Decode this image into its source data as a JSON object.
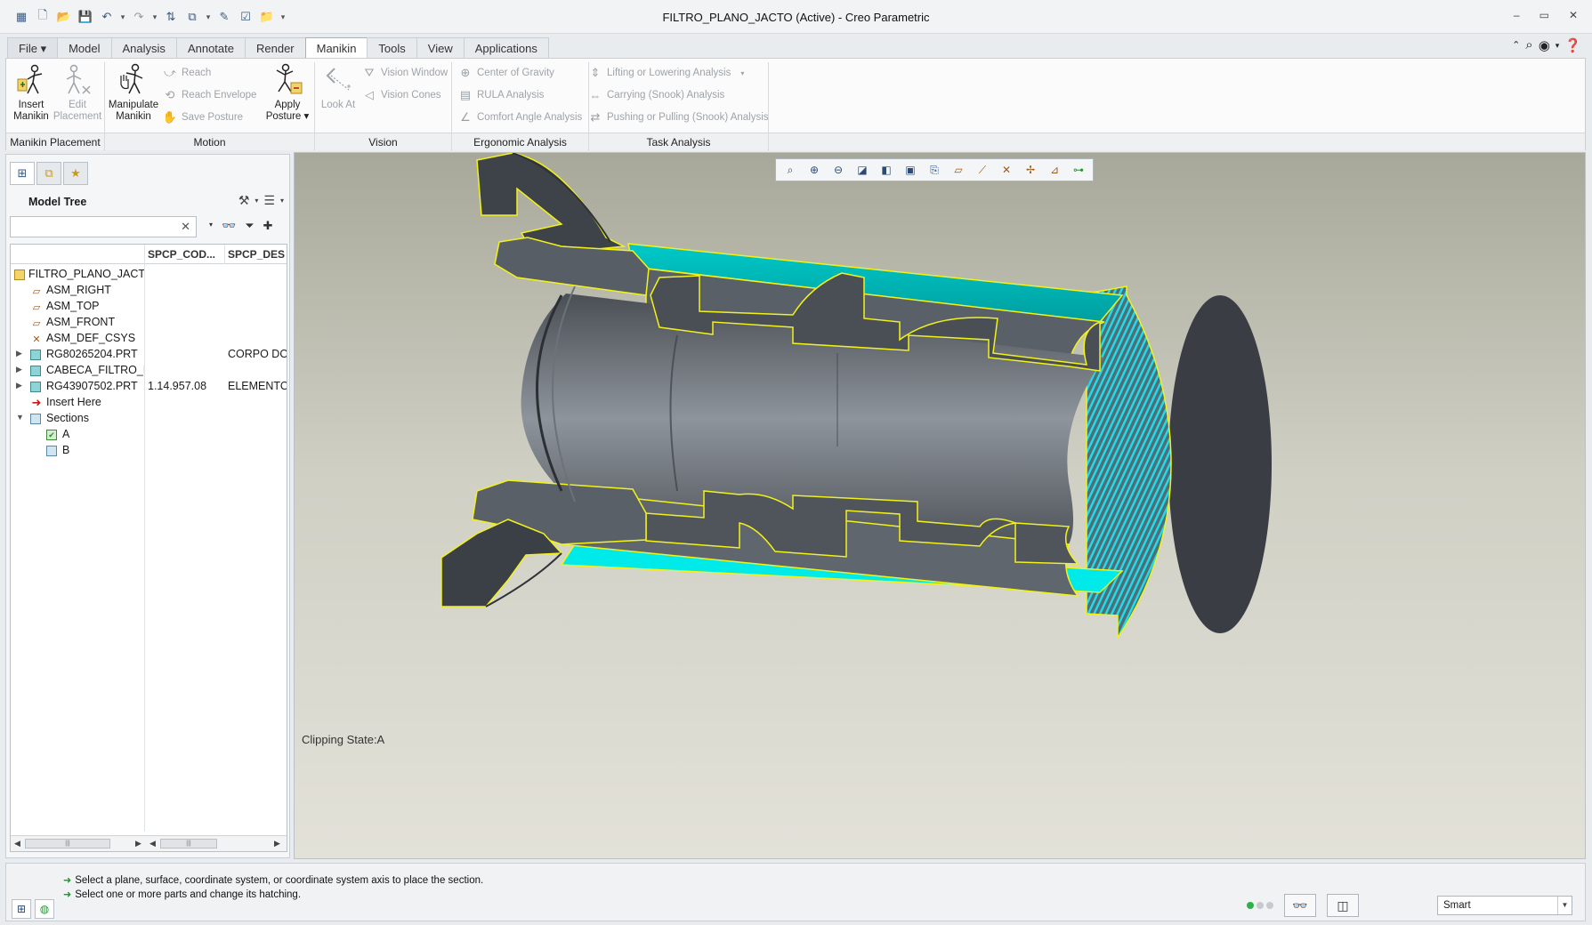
{
  "window": {
    "title": "FILTRO_PLANO_JACTO (Active) - Creo Parametric",
    "controls": [
      "minimize",
      "restore",
      "close"
    ]
  },
  "quick_access": [
    "app-icon",
    "new-icon",
    "open-icon",
    "save-icon",
    "undo-icon",
    "redo-icon",
    "regenerate-icon",
    "windows-icon",
    "edit-icon",
    "window-icon",
    "folder-icon",
    "customize-icon"
  ],
  "tabs": [
    {
      "label": "File",
      "dropdown": true
    },
    {
      "label": "Model"
    },
    {
      "label": "Analysis"
    },
    {
      "label": "Annotate"
    },
    {
      "label": "Render"
    },
    {
      "label": "Manikin",
      "active": true
    },
    {
      "label": "Tools"
    },
    {
      "label": "View"
    },
    {
      "label": "Applications"
    }
  ],
  "ribbon": {
    "groups": {
      "placement": "Manikin Placement",
      "motion": "Motion",
      "vision": "Vision",
      "ergonomic": "Ergonomic Analysis",
      "task": "Task Analysis"
    },
    "buttons": {
      "insert_manikin": [
        "Insert",
        "Manikin"
      ],
      "edit_placement": [
        "Edit",
        "Placement"
      ],
      "manipulate_manikin": [
        "Manipulate",
        "Manikin"
      ],
      "reach": "Reach",
      "reach_envelope": "Reach Envelope",
      "save_posture": "Save Posture",
      "apply_posture": [
        "Apply",
        "Posture"
      ],
      "look_at": "Look At",
      "vision_window": "Vision Window",
      "vision_cones": "Vision Cones",
      "center_of_gravity": "Center of Gravity",
      "rula_analysis": "RULA Analysis",
      "comfort_angle_analysis": "Comfort Angle Analysis",
      "lifting_lowering": "Lifting or Lowering Analysis",
      "carrying": "Carrying (Snook) Analysis",
      "pushing_pulling": "Pushing or Pulling (Snook) Analysis"
    }
  },
  "model_tree": {
    "title": "Model Tree",
    "search_value": "",
    "columns": [
      "SPCP_COD...",
      "SPCP_DES"
    ],
    "rows": [
      {
        "name": "FILTRO_PLANO_JACTO",
        "icon": "assembly-icon",
        "level": 0,
        "col2": "",
        "col3": ""
      },
      {
        "name": "ASM_RIGHT",
        "icon": "datum-plane-icon",
        "level": 1,
        "col2": "",
        "col3": ""
      },
      {
        "name": "ASM_TOP",
        "icon": "datum-plane-icon",
        "level": 1,
        "col2": "",
        "col3": ""
      },
      {
        "name": "ASM_FRONT",
        "icon": "datum-plane-icon",
        "level": 1,
        "col2": "",
        "col3": ""
      },
      {
        "name": "ASM_DEF_CSYS",
        "icon": "csys-icon",
        "level": 1,
        "col2": "",
        "col3": ""
      },
      {
        "name": "RG80265204.PRT",
        "icon": "part-icon",
        "level": 1,
        "expand": true,
        "col2": "",
        "col3": "CORPO DO"
      },
      {
        "name": "CABECA_FILTRO_P",
        "icon": "part-icon",
        "level": 1,
        "expand": true,
        "col2": "",
        "col3": ""
      },
      {
        "name": "RG43907502.PRT",
        "icon": "part-icon",
        "level": 1,
        "expand": true,
        "col2": "1.14.957.08",
        "col3": "ELEMENTO"
      },
      {
        "name": "Insert Here",
        "icon": "insert-arrow-icon",
        "level": 1,
        "col2": "",
        "col3": ""
      },
      {
        "name": "Sections",
        "icon": "sections-folder-icon",
        "level": 1,
        "expanded": true,
        "col2": "",
        "col3": ""
      },
      {
        "name": "A",
        "icon": "section-active-icon",
        "level": 2,
        "col2": "",
        "col3": ""
      },
      {
        "name": "B",
        "icon": "section-icon",
        "level": 2,
        "col2": "",
        "col3": ""
      }
    ]
  },
  "graphics": {
    "clipping_state": "Clipping State:A",
    "view_toolbar": [
      "refit-icon",
      "zoom-in-icon",
      "zoom-out-icon",
      "repaint-icon",
      "display-style-icon",
      "saved-views-icon",
      "view-manager-icon",
      "plane-display-icon",
      "axis-display-icon",
      "point-display-icon",
      "csys-display-icon",
      "annotation-display-icon",
      "spin-center-icon"
    ]
  },
  "status": {
    "messages": [
      "Select a plane, surface, coordinate system, or coordinate system axis to place the section.",
      "Select one or more parts and change its hatching."
    ],
    "filter": "Smart"
  },
  "colors": {
    "accent": "#2bb34a",
    "section_fill": "#00e5e5",
    "outline": "#f2f21a",
    "body": "#6b7178"
  }
}
